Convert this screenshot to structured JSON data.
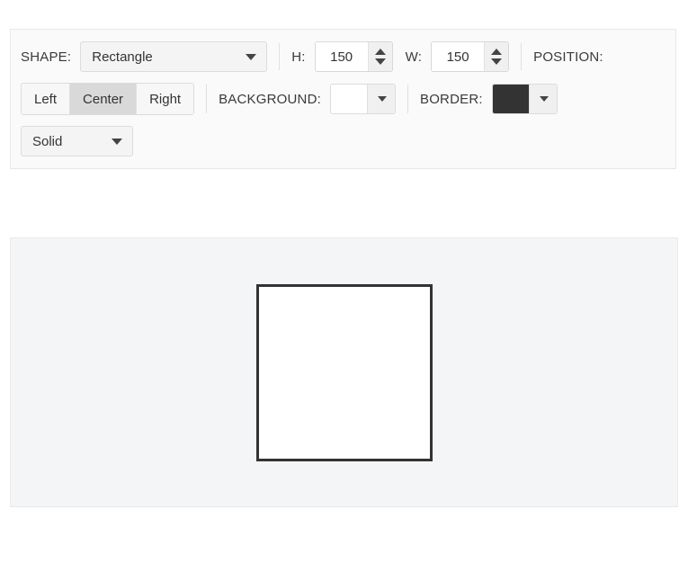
{
  "toolbar": {
    "shape_label": "SHAPE:",
    "shape_value": "Rectangle",
    "height_label": "H:",
    "height_value": "150",
    "width_label": "W:",
    "width_value": "150",
    "position_label": "POSITION:",
    "position_options": [
      "Left",
      "Center",
      "Right"
    ],
    "position_selected": "Center",
    "background_label": "BACKGROUND:",
    "background_color": "#ffffff",
    "border_label": "BORDER:",
    "border_color": "#333333",
    "border_style_value": "Solid"
  },
  "canvas": {
    "shape_fill": "#ffffff",
    "shape_border_color": "#333333"
  }
}
